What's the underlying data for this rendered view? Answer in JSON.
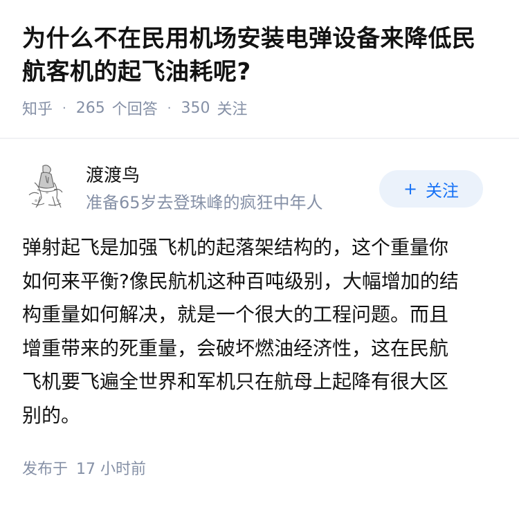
{
  "question": {
    "title_lines": [
      "为什么不在民用机场安装电弹设备来降低民",
      "航客机的起飞油耗呢?"
    ],
    "site": "知乎",
    "answers_count": "265",
    "answers_label": "个回答",
    "followers_count": "350",
    "followers_label": "关注"
  },
  "author": {
    "name": "渡渡鸟",
    "bio": "准备65岁去登珠峰的疯狂中年人",
    "follow_icon": "+",
    "follow_label": "关注"
  },
  "answer": {
    "lines": [
      "弹射起飞是加强飞机的起落架结构的，这个重量你",
      "如何来平衡?像民航机这种百吨级别，大幅增加的结",
      "构重量如何解决，就是一个很大的工程问题。而且",
      "增重带来的死重量，会破坏燃油经济性，这在民航",
      "飞机要飞遍全世界和军机只在航母上起降有很大区",
      "别的。"
    ],
    "posted_label": "发布于",
    "posted_time": "17 小时前"
  },
  "colors": {
    "text": "#121212",
    "meta": "#8590a6",
    "accent": "#1772f6",
    "follow_bg": "#ebf2fb"
  }
}
